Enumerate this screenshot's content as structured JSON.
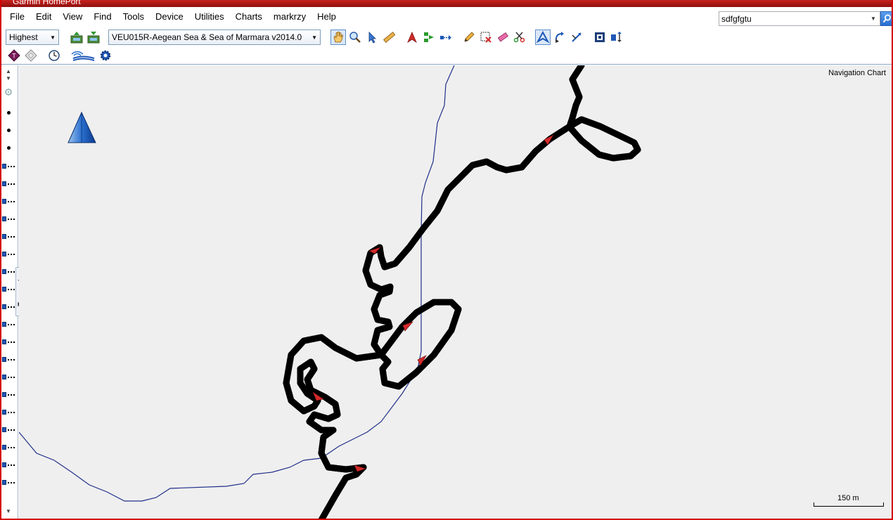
{
  "window": {
    "title": "Garmin HomePort"
  },
  "menu": [
    "File",
    "Edit",
    "View",
    "Find",
    "Tools",
    "Device",
    "Utilities",
    "Charts",
    "markrzy",
    "Help"
  ],
  "search": {
    "value": "sdfgfgtu"
  },
  "toolbar": {
    "detail_level": "Highest",
    "chart_product": "VEU015R-Aegean Sea & Sea of Marmara v2014.0",
    "icons_row1": [
      "send-to-device-icon",
      "receive-from-device-icon",
      "pan-hand-icon",
      "zoom-icon",
      "select-arrow-icon",
      "measure-ruler-icon",
      "new-waypoint-icon",
      "new-route-icon",
      "route-icon",
      "edit-pencil-icon",
      "erase-selection-icon",
      "eraser-icon",
      "scissors-icon",
      "navigation-triangle-icon",
      "rotate-icon",
      "swap-icon",
      "fit-to-screen-icon",
      "sync-icon"
    ],
    "icons_row2": [
      "tide-icon",
      "current-icon",
      "clock-icon",
      "wireless-signal-icon",
      "settings-gear-icon"
    ]
  },
  "map": {
    "label": "Navigation Chart",
    "scale_label": "150 m"
  }
}
